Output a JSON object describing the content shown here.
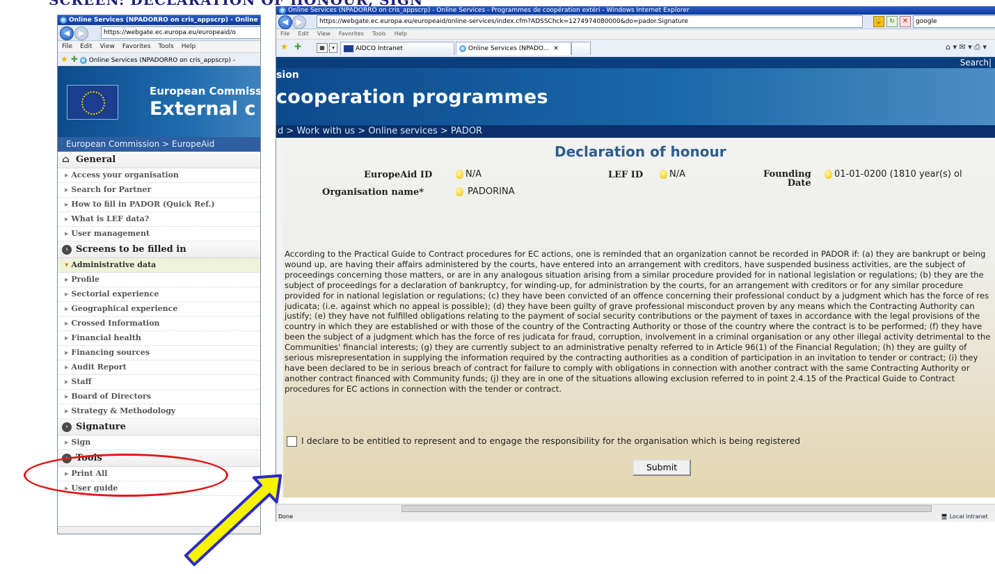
{
  "slide_title": "SCREEN: DECLARATION OF HONOUR, SIGN",
  "left_browser": {
    "title": "Online Services (NPADORRO on cris_appscrp) - Online",
    "address": "https://webgate.ec.europa.eu/europeaid/o",
    "menu": [
      "File",
      "Edit",
      "View",
      "Favorites",
      "Tools",
      "Help"
    ],
    "tab_label": "Online Services (NPADORRO on cris_appscrp) -",
    "banner_line1": "European Commissi",
    "banner_line2": "External c",
    "breadcrumb": "European Commission > EuropeAid",
    "sections": {
      "general": "General",
      "screens": "Screens to be filled in",
      "signature": "Signature",
      "tools": "Tools"
    },
    "general_items": [
      "Access your organisation",
      "Search for Partner",
      "How to fill in PADOR (Quick Ref.)",
      "What is LEF data?",
      "User management"
    ],
    "screen_items": [
      "Administrative data",
      "Profile",
      "Sectorial experience",
      "Geographical experience",
      "Crossed Information",
      "Financial health",
      "Financing sources",
      "Audit Report",
      "Staff",
      "Board of Directors",
      "Strategy & Methodology"
    ],
    "signature_items": [
      "Sign"
    ],
    "tool_items": [
      "Print All",
      "User guide"
    ]
  },
  "right_browser": {
    "title": "Online Services (NPADORRO on cris_appscrp) - Online Services - Programmes de coopération extéri - Windows Internet Explorer",
    "address": "https://webgate.ec.europa.eu/europeaid/online-services/index.cfm?ADSSChck=1274974080000&do=pador.Signature",
    "search_box": "google",
    "menu": [
      "File",
      "Edit",
      "View",
      "Favorites",
      "Tools",
      "Help"
    ],
    "tabs": [
      "AIDCO Intranet",
      "Online Services (NPADO..."
    ],
    "top_link": "Search|",
    "banner_small": "sion",
    "banner_big": "cooperation programmes",
    "breadcrumb": "d > Work with us > Online services > PADOR",
    "status": "Done",
    "zone": "Local intranet"
  },
  "form": {
    "title": "Declaration of honour",
    "europeaid_id_label": "EuropeAid ID",
    "europeaid_id_value": "N/A",
    "lef_id_label": "LEF ID",
    "lef_id_value": "N/A",
    "founding_label_1": "Founding",
    "founding_label_2": "Date",
    "founding_value": "01-01-0200 (1810 year(s) ol",
    "org_name_label": "Organisation name*",
    "org_name_value": "PADORINA",
    "declaration_text": "According to the Practical Guide to Contract procedures for EC actions, one is reminded that an organization cannot be recorded in PADOR if: (a) they are bankrupt or being wound up, are having their affairs administered by the courts, have entered into an arrangement with creditors, have suspended business activities, are the subject of proceedings concerning those matters, or are in any analogous situation arising from a similar procedure provided for in national legislation or regulations; (b) they are the subject of proceedings for a declaration of bankruptcy, for winding-up, for administration by the courts, for an arrangement with creditors or for any similar procedure provided for in national legislation or regulations; (c) they have been convicted of an offence concerning their professional conduct by a judgment which has the force of res judicata; (i.e. against which no appeal is possible); (d) they have been guilty of grave professional misconduct proven by any means which the Contracting Authority can justify; (e) they have not fulfilled obligations relating to the payment of social security contributions or the payment of taxes in accordance with the legal provisions of the country in which they are established or with those of the country of the Contracting Authority or those of the country where the contract is to be performed; (f) they have been the subject of a judgment which has the force of res judicata for fraud, corruption, involvement in a criminal organisation or any other illegal activity detrimental to the Communities' financial interests; (g) they are currently subject to an administrative penalty referred to in Article 96(1) of the Financial Regulation; (h) they are guilty of serious misrepresentation in supplying the information required by the contracting authorities as a condition of participation in an invitation to tender or contract; (i) they have been declared to be in serious breach of contract for failure to comply with obligations in connection with another contract with the same Contracting Authority or another contract financed with Community funds; (j) they are in one of the situations allowing exclusion referred to in point 2.4.15 of the Practical Guide to Contract procedures for EC actions in connection with the tender or contract.",
    "checkbox_label": "I declare to be entitled to represent and to engage the responsibility for the organisation which is being registered",
    "submit_label": "Submit"
  },
  "colors": {
    "highlight_oval": "#e01818",
    "arrow_fill": "#f7f200",
    "arrow_stroke": "#2a2ac8"
  }
}
